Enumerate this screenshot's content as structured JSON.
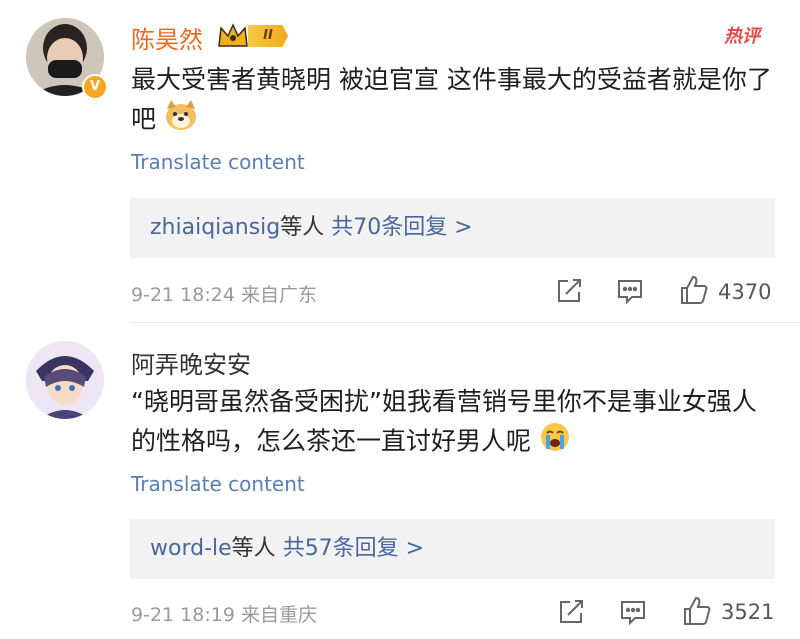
{
  "hot_badge": "热评",
  "comments": [
    {
      "username": "陈昊然",
      "rank_badge": "II",
      "text": "最大受害者黄晓明 被迫官宣 这件事最大的受益者就是你了吧",
      "emoji": "doge-icon",
      "translate": "Translate content",
      "reply_user": "zhiaiqiansig",
      "reply_mid": "等人",
      "reply_count": "共70条回复 >",
      "timestamp": "9-21 18:24 来自广东",
      "likes": "4370",
      "name_color": "#e86b1f"
    },
    {
      "username": "阿弄晚安安",
      "text": "“晓明哥虽然备受困扰”姐我看营销号里你不是事业女强人的性格吗，怎么茶还一直讨好男人呢",
      "emoji": "crying-emoji-icon",
      "translate": "Translate content",
      "reply_user": "word-le",
      "reply_mid": "等人",
      "reply_count": "共57条回复 >",
      "timestamp": "9-21 18:19 来自重庆",
      "likes": "3521",
      "name_color": "#333333"
    }
  ]
}
